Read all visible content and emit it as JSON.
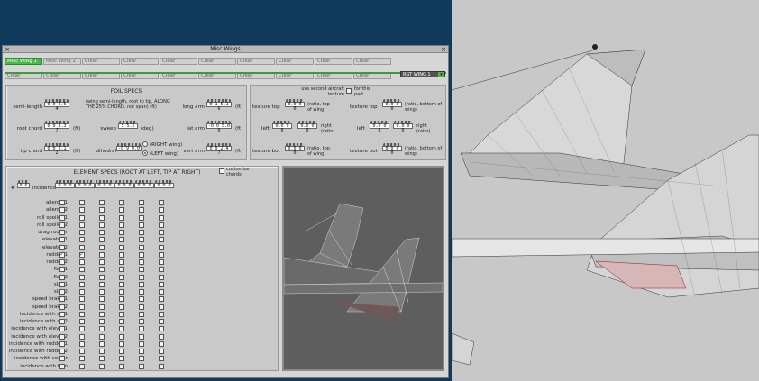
{
  "window": {
    "title": "Misc Wings"
  },
  "tabs_row1": [
    "Misc Wing 1",
    "Misc Wing 2",
    "Clear",
    "Clear",
    "Clear",
    "Clear",
    "Clear",
    "Clear",
    "Clear",
    "Clear"
  ],
  "tabs_row2": [
    "Clear",
    "Clear",
    "Clear",
    "Clear",
    "Clear",
    "Clear",
    "Clear",
    "Clear",
    "Clear",
    "Clear"
  ],
  "wing_select": "RGT WING 1",
  "foil": {
    "title": "FOIL SPECS",
    "semi_length_label": "semi-length",
    "semi_length": "0 0 2.6 4",
    "semi_length_note": "(wing semi-length, root to tip, ALONG THE 25% CHORD, not span) (ft)",
    "root_chord_label": "root chord",
    "root_chord": "0 0 3.3 7",
    "root_chord_unit": "(ft)",
    "tip_chord_label": "tip chord",
    "tip_chord": "0 0 2.1 2",
    "tip_chord_unit": "(ft)",
    "sweep_label": "sweep",
    "sweep": "5 5.2",
    "sweep_unit": "(deg)",
    "dihedral_label": "dihedral",
    "dihedral": "-0 9 0.0",
    "right_wing": "(RIGHT wing)",
    "left_wing": "(LEFT wing)",
    "long_arm_label": "long arm",
    "long_arm": "0 1 5.1 6",
    "long_arm_unit": "(ft)",
    "lat_arm_label": "lat arm",
    "lat_arm": "-0 0 5.0 0",
    "lat_arm_unit": "(ft)",
    "vert_arm_label": "vert arm",
    "vert_arm": "0 0 2.4 7",
    "vert_arm_unit": "(ft)"
  },
  "texture": {
    "use_second": "use second aircraft texture",
    "for_part": "for this part",
    "top_label": "texture top",
    "left_top": "0.0 0 0",
    "left_top_note": "(ratio, top of wing)",
    "right_top": "0.0 0 0",
    "right_top_note": "(ratio, bottom of wing)",
    "left_label": "left",
    "left_a": "0.0 0 0",
    "left_b": "0.0 0 0",
    "right_ratio": "right (ratio)",
    "left2_label": "left",
    "left2_a": "0.0 0 0",
    "left2_b": "0.0 0 0",
    "right2_ratio": "right (ratio)",
    "bot_label": "texture bot",
    "left_bot": "0.0 0 0",
    "left_bot_note": "(ratio, top of wing)",
    "right_bot": "0.0 0 0",
    "right_bot_note": "(ratio, bottom of wing)"
  },
  "elements": {
    "title": "ELEMENT SPECS (ROOT AT LEFT, TIP AT RIGHT)",
    "customize": "customize chords",
    "hash": "#",
    "count": "0 6",
    "incidence_label": "incidence",
    "incidence_values": [
      "0 0.0",
      "0 0.0",
      "0 0.0",
      "0 0.0",
      "0 0.0",
      "0 0.0"
    ],
    "rows": [
      "aileron 1",
      "aileron 2",
      "roll spoiler 1",
      "roll spoiler 2",
      "drag rudder",
      "elevator 1",
      "elevator 2",
      "rudder 1",
      "rudder 2",
      "flap 1",
      "flap 2",
      "slat 1",
      "slat 2",
      "speed brake 1",
      "speed brake 2",
      "incidence with ail 1",
      "incidence with ail 2",
      "incidence with elevtr 1",
      "incidence with elevtr 2",
      "incidence with rudder 1",
      "incidence with rudder 2",
      "incidence with vector",
      "incidence with trim"
    ],
    "checked": [
      [
        7,
        0
      ],
      [
        7,
        1
      ]
    ]
  }
}
